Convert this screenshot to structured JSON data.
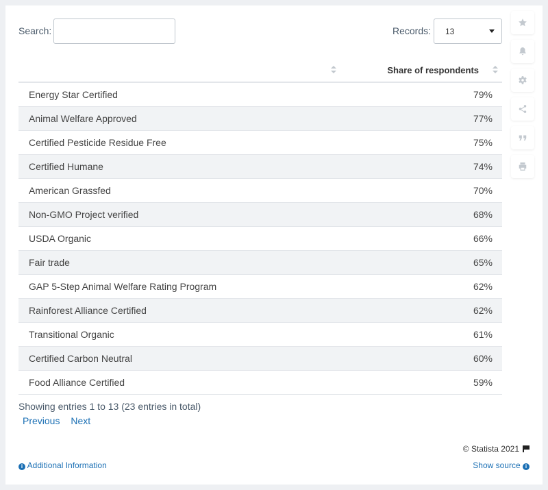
{
  "search": {
    "label": "Search:",
    "value": ""
  },
  "records": {
    "label": "Records:",
    "selected": "13"
  },
  "table": {
    "columns": [
      "",
      "Share of respondents"
    ],
    "rows": [
      {
        "label": "Energy Star Certified",
        "value": "79%"
      },
      {
        "label": "Animal Welfare Approved",
        "value": "77%"
      },
      {
        "label": "Certified Pesticide Residue Free",
        "value": "75%"
      },
      {
        "label": "Certified Humane",
        "value": "74%"
      },
      {
        "label": "American Grassfed",
        "value": "70%"
      },
      {
        "label": "Non-GMO Project verified",
        "value": "68%"
      },
      {
        "label": "USDA Organic",
        "value": "66%"
      },
      {
        "label": "Fair trade",
        "value": "65%"
      },
      {
        "label": "GAP 5-Step Animal Welfare Rating Program",
        "value": "62%"
      },
      {
        "label": "Rainforest Alliance Certified",
        "value": "62%"
      },
      {
        "label": "Transitional Organic",
        "value": "61%"
      },
      {
        "label": "Certified Carbon Neutral",
        "value": "60%"
      },
      {
        "label": "Food Alliance Certified",
        "value": "59%"
      }
    ]
  },
  "footer": {
    "info": "Showing entries 1 to 13 (23 entries in total)",
    "previous": "Previous",
    "next": "Next",
    "copyright": "© Statista 2021",
    "additional_info": "Additional Information",
    "show_source": "Show source"
  },
  "tools": [
    "star-icon",
    "bell-icon",
    "gear-icon",
    "share-icon",
    "quote-icon",
    "print-icon"
  ],
  "colors": {
    "link": "#1a6fb4",
    "stripe": "#f1f3f5",
    "background": "#eef0f3"
  }
}
